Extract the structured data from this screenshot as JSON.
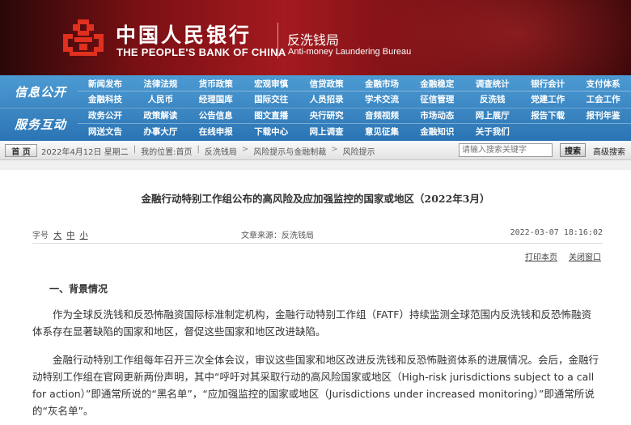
{
  "header": {
    "bank_cn": "中国人民银行",
    "bank_en": "THE PEOPLE'S BANK OF CHINA",
    "dept_cn": "反洗钱局",
    "dept_en": "Anti-money Laundering Bureau"
  },
  "nav": {
    "section1": "信息公开",
    "section2": "服务互动",
    "rows": [
      [
        "新闻发布",
        "法律法规",
        "货币政策",
        "宏观审慎",
        "信贷政策",
        "金融市场",
        "金融稳定",
        "调查统计",
        "银行会计",
        "支付体系"
      ],
      [
        "金融科技",
        "人民币",
        "经理国库",
        "国际交往",
        "人员招录",
        "学术交流",
        "征信管理",
        "反洗钱",
        "党建工作",
        "工会工作"
      ],
      [
        "政务公开",
        "政策解读",
        "公告信息",
        "图文直播",
        "央行研究",
        "音频视频",
        "市场动态",
        "网上展厅",
        "报告下载",
        "报刊年鉴"
      ],
      [
        "网送文告",
        "办事大厅",
        "在线申报",
        "下载中心",
        "网上调查",
        "意见征集",
        "金融知识",
        "关于我们",
        "",
        ""
      ]
    ]
  },
  "breadcrumb": {
    "home": "首 页",
    "date": "2022年4月12日 星期二",
    "location_label": "我的位置:",
    "items": [
      "首页",
      "反洗钱局",
      "风险提示与金融制裁",
      "风险提示"
    ],
    "sep": "|",
    "arrow": ">"
  },
  "search": {
    "placeholder": "请输入搜索关键字",
    "button": "搜索",
    "advanced": "高级搜索"
  },
  "article": {
    "title": "金融行动特别工作组公布的高风险及应加强监控的国家或地区（2022年3月）",
    "font_label": "字号",
    "font_sizes": [
      "大",
      "中",
      "小"
    ],
    "source": "文章来源：反洗钱局",
    "datetime": "2022-03-07 18:16:02",
    "print": "打印本页",
    "close": "关闭窗口",
    "section_head": "一、背景情况",
    "para1": "作为全球反洗钱和反恐怖融资国际标准制定机构，金融行动特别工作组（FATF）持续监测全球范围内反洗钱和反恐怖融资体系存在显著缺陷的国家和地区，督促这些国家和地区改进缺陷。",
    "para2": "金融行动特别工作组每年召开三次全体会议，审议这些国家和地区改进反洗钱和反恐怖融资体系的进展情况。会后，金融行动特别工作组在官网更新两份声明，其中“呼吁对其采取行动的高风险国家或地区（High-risk jurisdictions subject to a call for action）”即通常所说的“黑名单”，“应加强监控的国家或地区（Jurisdictions under increased monitoring）”即通常所说的“灰名单”。"
  },
  "colors": {
    "banner": "#a31a1f",
    "nav": "#2b74b4",
    "logo": "#e0301e"
  }
}
